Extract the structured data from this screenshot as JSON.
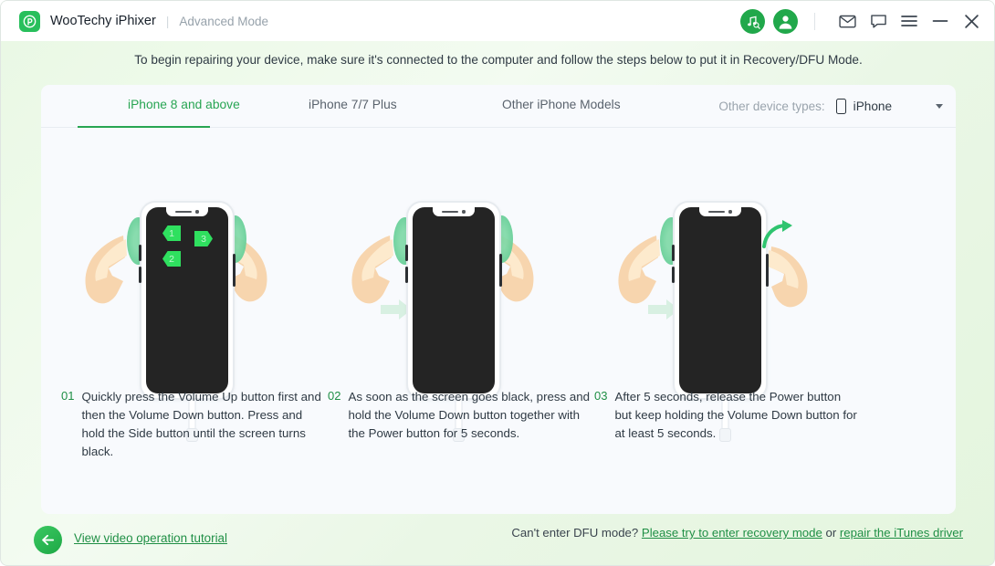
{
  "window": {
    "logo_icon": "phixer-logo-icon",
    "brand": "WooTechy iPhixer",
    "separator": "|",
    "mode": "Advanced Mode"
  },
  "titlebar_actions": [
    {
      "name": "itunes-detect-icon",
      "label": "iTunes detect"
    },
    {
      "name": "account-avatar-icon",
      "label": "Account"
    },
    {
      "name": "mail-icon",
      "label": "Feedback mail"
    },
    {
      "name": "chat-icon",
      "label": "Live chat"
    },
    {
      "name": "menu-icon",
      "label": "Menu"
    },
    {
      "name": "minimize-icon",
      "label": "Minimize"
    },
    {
      "name": "close-icon",
      "label": "Close"
    }
  ],
  "banner": {
    "text": "To begin repairing your device, make sure it's connected to the computer and follow the steps below to put it in Recovery/DFU Mode."
  },
  "tabs": [
    {
      "label": "iPhone 8 and above",
      "active": true
    },
    {
      "label": "iPhone 7/7 Plus",
      "active": false
    },
    {
      "label": "Other iPhone Models",
      "active": false
    }
  ],
  "device_type": {
    "label": "Other device types:",
    "glyph": "iphone-glyph",
    "value": "iPhone",
    "caret": "chevron-down-icon"
  },
  "steps": [
    {
      "num": "01",
      "text": "Quickly press the Volume Up button first and then the Volume Down button. Press and hold the Side button until the screen turns black.",
      "badges": [
        "1",
        "2",
        "3"
      ]
    },
    {
      "num": "02",
      "text": "As soon as the screen goes black, press and hold the Volume Down button together with the Power button for 5 seconds.",
      "badges": []
    },
    {
      "num": "03",
      "text": "After 5 seconds, release the Power button but keep holding the Volume Down button for at least 5 seconds.",
      "badges": []
    }
  ],
  "footer": {
    "back_icon": "back-arrow-icon",
    "tutorial_link": "View video operation tutorial",
    "help_prefix": "Can't enter DFU mode?",
    "help_link_1": "Please try to enter recovery mode",
    "help_conjunction": "or",
    "help_link_2": "repair the iTunes driver"
  },
  "colors": {
    "brand_green": "#28bf5c",
    "accent_green": "#1f8f45",
    "active_tab": "#28a552",
    "badge_green": "#2fe05f",
    "card_bg": "#f8fafd",
    "screen_black": "#242424"
  }
}
